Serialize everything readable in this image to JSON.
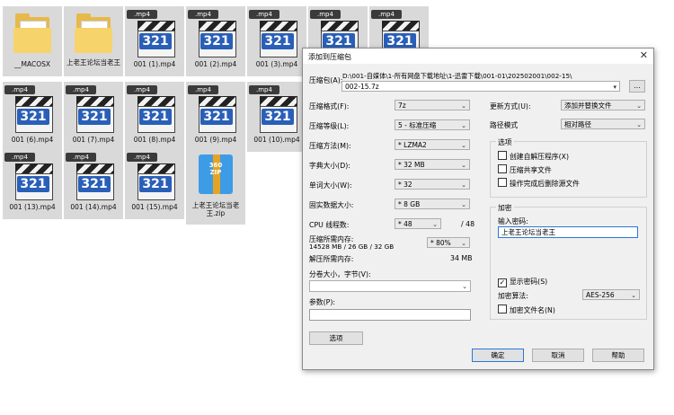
{
  "desktop": {
    "files": [
      {
        "type": "folder",
        "label": "__MACOSX"
      },
      {
        "type": "folder",
        "label": "上老王论坛当老王"
      },
      {
        "type": "mp4",
        "label": "001 (1).mp4"
      },
      {
        "type": "mp4",
        "label": "001 (2).mp4"
      },
      {
        "type": "mp4",
        "label": "001 (3).mp4"
      },
      {
        "type": "mp4",
        "label": ""
      },
      {
        "type": "mp4",
        "label": ""
      },
      {
        "type": "mp4",
        "label": "001 (6).mp4"
      },
      {
        "type": "mp4",
        "label": "001 (7).mp4"
      },
      {
        "type": "mp4",
        "label": "001 (8).mp4"
      },
      {
        "type": "mp4",
        "label": "001 (9).mp4"
      },
      {
        "type": "mp4",
        "label": "001 (10).mp4"
      },
      {
        "type": "mp4",
        "label": "001 (13).mp4"
      },
      {
        "type": "mp4",
        "label": "001 (14).mp4"
      },
      {
        "type": "mp4",
        "label": "001 (15).mp4"
      },
      {
        "type": "zip",
        "label": "上老王论坛当老王.zip"
      }
    ],
    "mp4_tag": ".mp4",
    "mp4_icon_text": "321",
    "zip_icon_text_1": "360",
    "zip_icon_text_2": "ZIP"
  },
  "dialog": {
    "title": "添加到压缩包",
    "close": "✕",
    "archive_label": "压缩包(A):",
    "archive_path": "D:\\001-自媒体\\1-所有网盘下载地址\\1-迅雷下载\\001-01\\202502001\\002-15\\",
    "archive_name": "002-15.7z",
    "browse": "...",
    "format_label": "压缩格式(F):",
    "format_value": "7z",
    "level_label": "压缩等级(L):",
    "level_value": "5 - 标准压缩",
    "method_label": "压缩方法(M):",
    "method_value": "* LZMA2",
    "dict_label": "字典大小(D):",
    "dict_value": "* 32 MB",
    "word_label": "单词大小(W):",
    "word_value": "* 32",
    "solid_label": "固实数据大小:",
    "solid_value": "* 8 GB",
    "cpu_label": "CPU 线程数:",
    "cpu_value": "* 48",
    "cpu_total": "/ 48",
    "mem_label": "压缩所需内存:",
    "mem_detail": "14528 MB / 26 GB / 32 GB",
    "mem_percent": "* 80%",
    "decomp_label": "解压所需内存:",
    "decomp_value": "34 MB",
    "split_label": "分卷大小，字节(V):",
    "params_label": "参数(P):",
    "options_btn": "选项",
    "update_label": "更新方式(U):",
    "update_value": "添加并替换文件",
    "path_label": "路径模式",
    "path_value": "相对路径",
    "options_group": "选项",
    "opt_sfx": "创建自解压程序(X)",
    "opt_shared": "压缩共享文件",
    "opt_delete": "操作完成后删除源文件",
    "enc_group": "加密",
    "password_label": "输入密码:",
    "password_value": "上老王论坛当老王",
    "show_password": "显示密码(S)",
    "enc_method_label": "加密算法:",
    "enc_method_value": "AES-256",
    "enc_names": "加密文件名(N)",
    "ok": "确定",
    "cancel": "取消",
    "help": "帮助"
  }
}
